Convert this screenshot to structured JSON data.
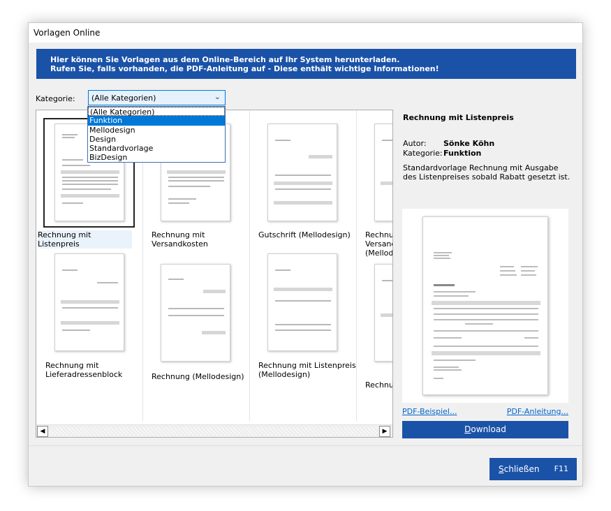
{
  "window": {
    "title": "Vorlagen Online"
  },
  "banner": {
    "line1": "Hier können Sie Vorlagen aus dem Online-Bereich auf Ihr System herunterladen.",
    "line2": "Rufen Sie, falls vorhanden, die PDF-Anleitung auf - Diese enthält wichtige Informationen!",
    "color": "#1a52a8"
  },
  "category": {
    "label": "Kategorie:",
    "value": "(Alle Kategorien)",
    "options": [
      "(Alle Kategorien)",
      "Funktion",
      "Mellodesign",
      "Design",
      "Standardvorlage",
      "BizDesign"
    ],
    "highlighted": "Funktion"
  },
  "gallery": {
    "items": [
      {
        "caption": "Rechnung mit Listenpreis",
        "selected": true
      },
      {
        "caption": "Rechnung mit\nVersandkosten"
      },
      {
        "caption": "Gutschrift (Mellodesign)"
      },
      {
        "caption": "Rechnung mit\nVersandkosten\n(Mellodesign)",
        "display": "Rechnur\nVersand\n(Mellode"
      },
      {
        "caption": "Rechnung mit\nLieferadressenblock"
      },
      {
        "caption": "Rechnung (Mellodesign)"
      },
      {
        "caption": "Rechnung mit Listenpreis\n(Mellodesign)"
      },
      {
        "caption": "Rechnur",
        "display": "Rechnur"
      }
    ]
  },
  "detail": {
    "title": "Rechnung mit Listenpreis",
    "author_label": "Autor:",
    "author": "Sönke Köhn",
    "category_label": "Kategorie:",
    "category": "Funktion",
    "description": "Standardvorlage Rechnung mit Ausgabe des Listenpreises sobald Rabatt gesetzt ist.",
    "pdf_example": "PDF-Beispiel...",
    "pdf_manual": "PDF-Anleitung...",
    "download_accel": "D",
    "download_rest": "ownload"
  },
  "footer": {
    "close_accel": "S",
    "close_rest": "chließen",
    "close_key": "F11"
  },
  "colors": {
    "accent": "#1a52a8",
    "selection": "#0078d7",
    "link": "#0066cc"
  }
}
